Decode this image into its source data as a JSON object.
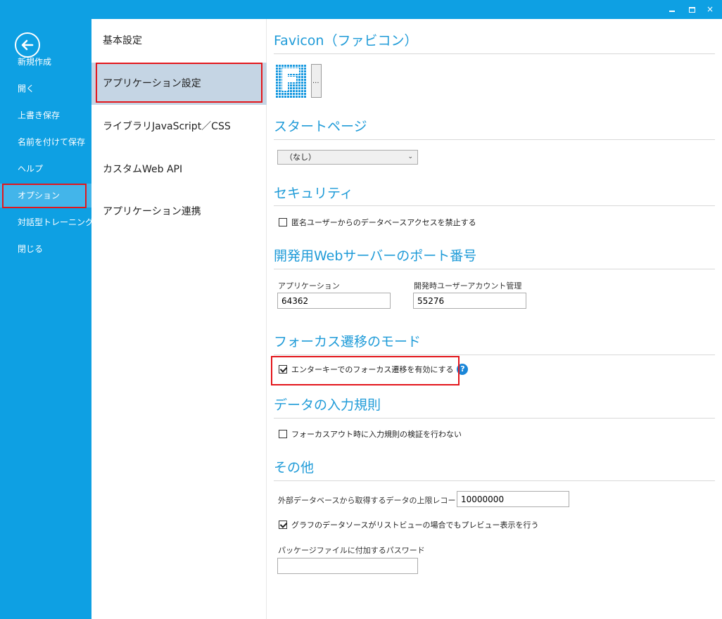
{
  "window": {
    "controls": {
      "minimize": "minimize",
      "maximize": "maximize",
      "close": "×"
    }
  },
  "sidebar": {
    "back_icon": "back-arrow-icon",
    "items": [
      {
        "label": "新規作成"
      },
      {
        "label": "開く"
      },
      {
        "label": "上書き保存"
      },
      {
        "label": "名前を付けて保存"
      },
      {
        "label": "ヘルプ"
      },
      {
        "label": "オプション",
        "active": true
      },
      {
        "label": "対話型トレーニング"
      },
      {
        "label": "閉じる"
      }
    ],
    "color": "#0ea0e3",
    "highlight_color": "#e3161b"
  },
  "categories": [
    {
      "label": "基本設定"
    },
    {
      "label": "アプリケーション設定",
      "selected": true
    },
    {
      "label": "ライブラリJavaScript／CSS"
    },
    {
      "label": "カスタムWeb API"
    },
    {
      "label": "アプリケーション連携"
    }
  ],
  "sections": {
    "favicon": {
      "title": "Favicon（ファビコン）",
      "button_label": "..."
    },
    "start_page": {
      "title": "スタートページ",
      "selected": "（なし）"
    },
    "security": {
      "title": "セキュリティ",
      "checkbox_label": "匿名ユーザーからのデータベースアクセスを禁止する",
      "checked": false
    },
    "port": {
      "title": "開発用Webサーバーのポート番号",
      "app_label": "アプリケーション",
      "app_value": "64362",
      "account_label": "開発時ユーザーアカウント管理",
      "account_value": "55276"
    },
    "focus": {
      "title": "フォーカス遷移のモード",
      "checkbox_label": "エンターキーでのフォーカス遷移を有効にする",
      "checked": true,
      "help": "?"
    },
    "input_rules": {
      "title": "データの入力規則",
      "checkbox_label": "フォーカスアウト時に入力規則の検証を行わない",
      "checked": false
    },
    "other": {
      "title": "その他",
      "limit_label": "外部データベースから取得するデータの上限レコード数",
      "limit_value": "10000000",
      "graph_checkbox_label": "グラフのデータソースがリストビューの場合でもプレビュー表示を行う",
      "graph_checked": true,
      "password_label": "パッケージファイルに付加するパスワード",
      "password_value": ""
    }
  },
  "colors": {
    "accent": "#1f9bd8",
    "selected_bg": "#c5d5e4"
  }
}
